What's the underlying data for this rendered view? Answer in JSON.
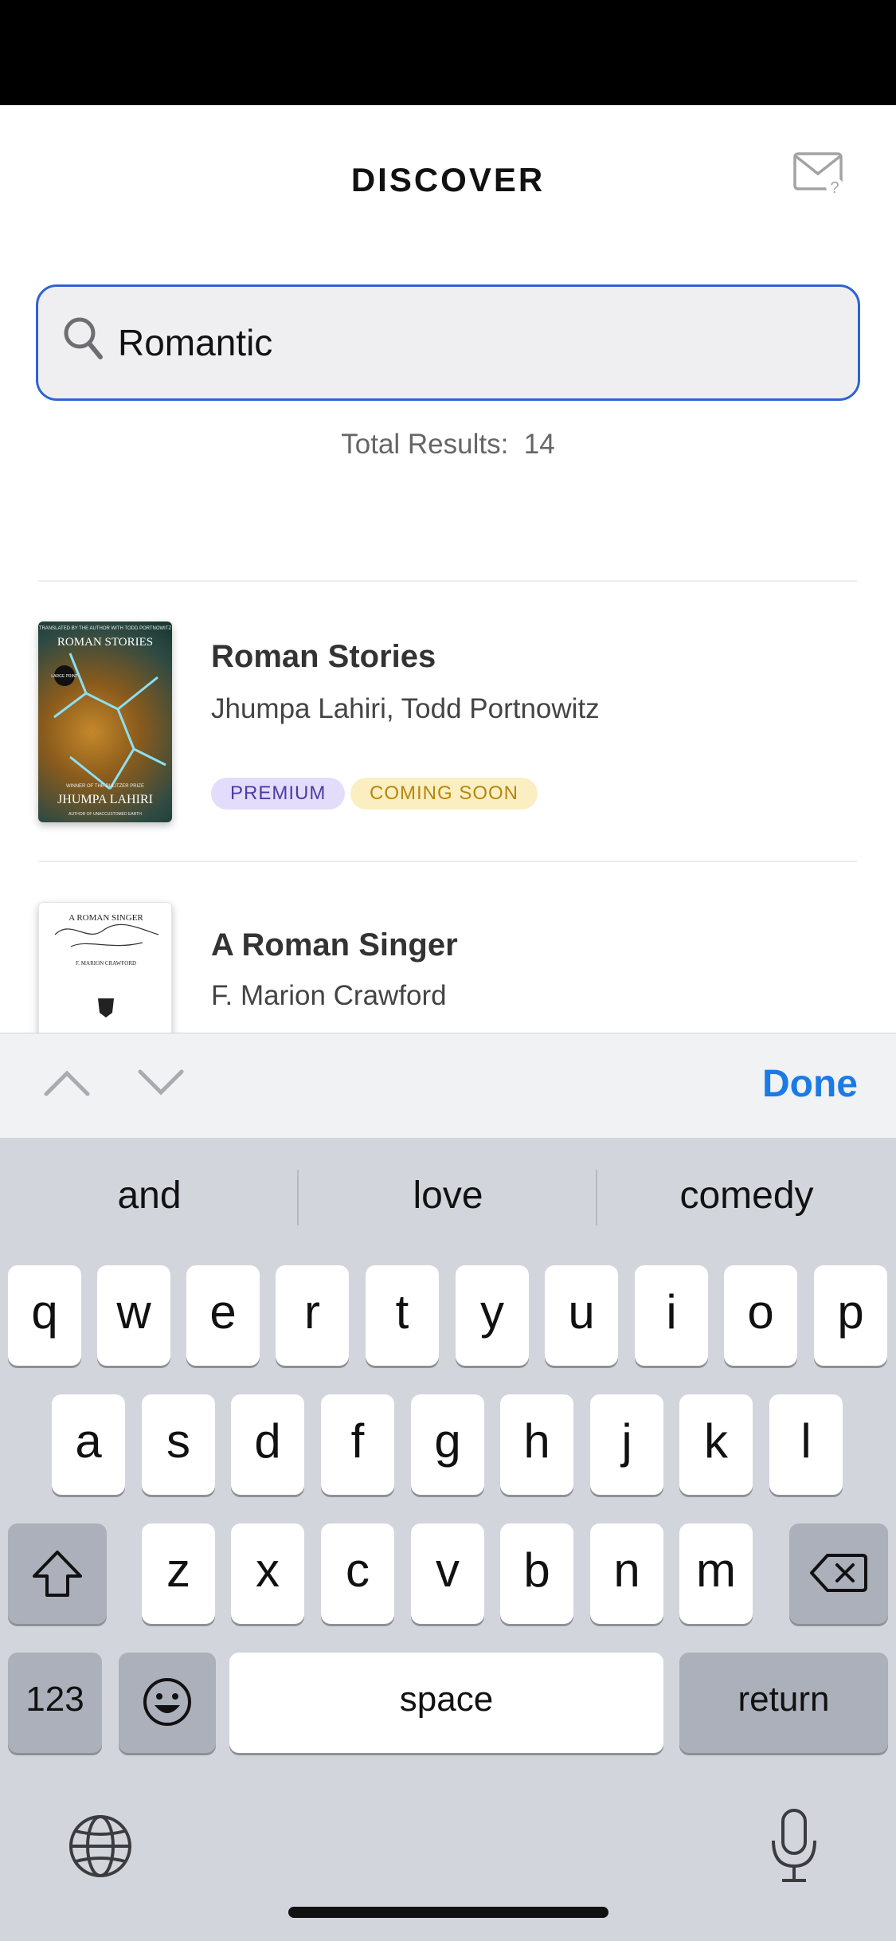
{
  "header": {
    "title": "DISCOVER",
    "mail_icon": "mail-help-icon"
  },
  "search": {
    "value": "Romantic",
    "icon": "search-icon"
  },
  "results_summary": {
    "label": "Total Results:",
    "count": "14"
  },
  "results": [
    {
      "title": "Roman Stories",
      "author": "Jhumpa Lahiri, Todd Portnowitz",
      "badges": [
        "PREMIUM",
        "COMING SOON"
      ],
      "cover_text": {
        "top": "TRANSLATED BY THE AUTHOR WITH TODD PORTNOWITZ",
        "title": "ROMAN STORIES",
        "mark": "LARGE PRINT",
        "award": "WINNER OF THE PULITZER PRIZE",
        "author": "JHUMPA LAHIRI",
        "bottom": "AUTHOR OF UNACCUSTOMED EARTH"
      }
    },
    {
      "title": "A Roman Singer",
      "author": "F. Marion Crawford",
      "cover_text": {
        "title": "A ROMAN SINGER",
        "author": "F. MARION CRAWFORD"
      }
    }
  ],
  "keyboard": {
    "accessory": {
      "done_label": "Done",
      "prev_icon": "chevron-up-icon",
      "next_icon": "chevron-down-icon"
    },
    "suggestions": [
      "and",
      "love",
      "comedy"
    ],
    "row1": [
      "q",
      "w",
      "e",
      "r",
      "t",
      "y",
      "u",
      "i",
      "o",
      "p"
    ],
    "row2": [
      "a",
      "s",
      "d",
      "f",
      "g",
      "h",
      "j",
      "k",
      "l"
    ],
    "row3": [
      "z",
      "x",
      "c",
      "v",
      "b",
      "n",
      "m"
    ],
    "numbers_label": "123",
    "space_label": "space",
    "return_label": "return"
  }
}
